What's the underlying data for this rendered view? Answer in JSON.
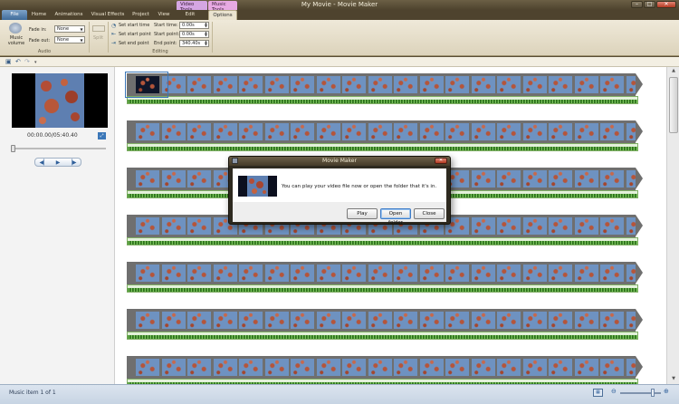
{
  "window": {
    "title": "My Movie - Movie Maker",
    "contextual_tabs": [
      "Video Tools",
      "Music Tools"
    ],
    "controls": {
      "minimize": "–",
      "maximize": "□",
      "close": "✕"
    }
  },
  "tabs": [
    "File",
    "Home",
    "Animations",
    "Visual Effects",
    "Project",
    "View",
    "Edit",
    "Options"
  ],
  "ribbon": {
    "audio": {
      "group_label": "Audio",
      "music_volume_label": "Music volume",
      "fade_in_label": "Fade in:",
      "fade_in_value": "None",
      "fade_out_label": "Fade out:",
      "fade_out_value": "None"
    },
    "split_label": "Split",
    "editing": {
      "group_label": "Editing",
      "set_start_time": "Set start time",
      "set_start_point": "Set start point",
      "set_end_point": "Set end point",
      "start_time_label": "Start time:",
      "start_time_value": "0.00s",
      "start_point_label": "Start point:",
      "start_point_value": "0.00s",
      "end_point_label": "End point:",
      "end_point_value": "340.40s"
    }
  },
  "preview": {
    "timecode": "00:00.00/05:40.40"
  },
  "storyboard": {
    "rows": 7,
    "frames_per_row": 20
  },
  "statusbar": {
    "text": "Music item 1 of 1"
  },
  "dialog": {
    "title": "Movie Maker",
    "message": "You can play your video file now or open the folder that it's in.",
    "buttons": {
      "play": "Play",
      "open_folder": "Open folder",
      "close": "Close"
    }
  },
  "colors": {
    "title_bar": "#5a4e36",
    "ribbon": "#e6dfcb",
    "film_strip": "#6f6f6f",
    "audio_wave": "#3f8a2a",
    "status_bar": "#cdd9e7"
  }
}
